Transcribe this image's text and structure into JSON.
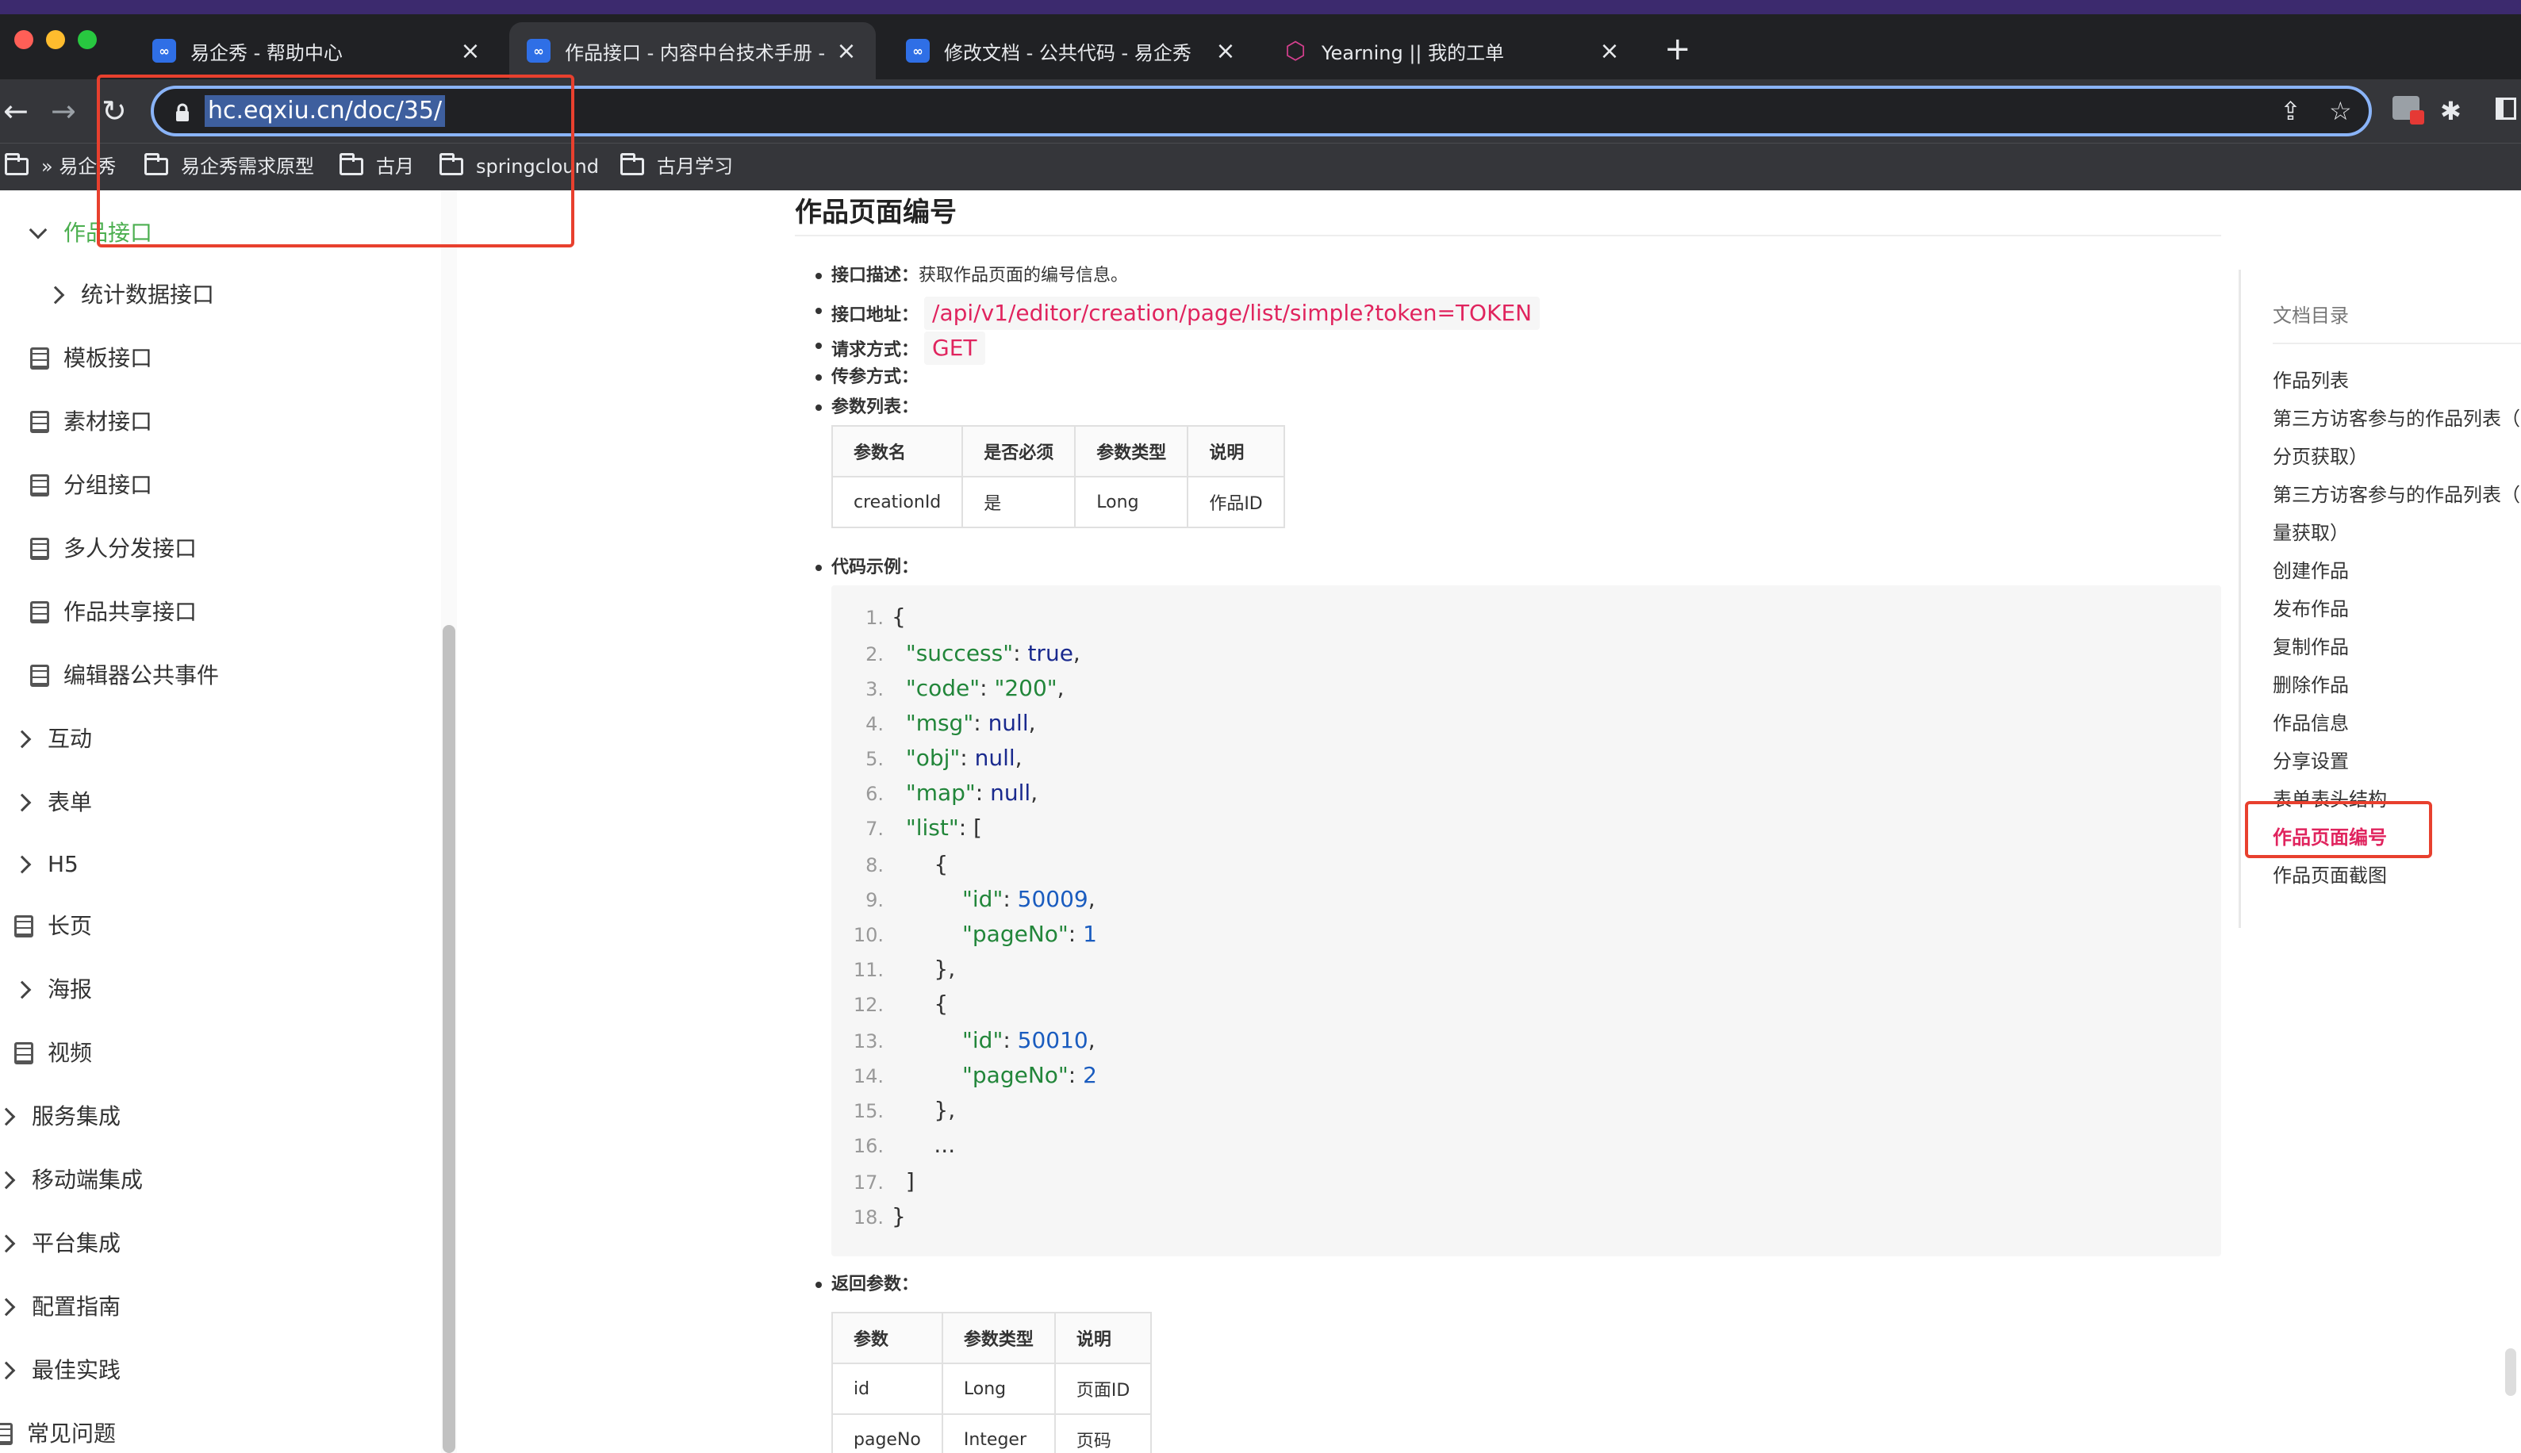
{
  "browser": {
    "tabs": [
      {
        "label": "易企秀 - 帮助中心",
        "favicon": "eqxiu-logo-icon"
      },
      {
        "label": "作品接口 - 内容中台技术手册 - 易",
        "favicon": "eqxiu-logo-icon",
        "active": true
      },
      {
        "label": "修改文档 - 公共代码 - 易企秀",
        "favicon": "eqxiu-logo-icon"
      },
      {
        "label": "Yearning || 我的工单",
        "favicon": "yearning-logo-icon"
      }
    ],
    "favicon_text": "∞",
    "close_glyph": "×",
    "newtab_glyph": "+",
    "url": "hc.eqxiu.cn/doc/35/",
    "bookmarks": [
      "» 易企秀",
      "易企秀需求原型",
      "古月",
      "springclound",
      "古月学习"
    ],
    "accent": "#8ab4f8"
  },
  "sidebar": {
    "items": [
      {
        "label": "作品接口",
        "type": "expanded",
        "active": true
      },
      {
        "label": "统计数据接口",
        "type": "collapsed"
      },
      {
        "label": "模板接口",
        "type": "doc"
      },
      {
        "label": "素材接口",
        "type": "doc"
      },
      {
        "label": "分组接口",
        "type": "doc"
      },
      {
        "label": "多人分发接口",
        "type": "doc"
      },
      {
        "label": "作品共享接口",
        "type": "doc"
      },
      {
        "label": "编辑器公共事件",
        "type": "doc"
      },
      {
        "label": "互动",
        "type": "collapsed"
      },
      {
        "label": "表单",
        "type": "collapsed"
      },
      {
        "label": "H5",
        "type": "collapsed"
      },
      {
        "label": "长页",
        "type": "doc"
      },
      {
        "label": "海报",
        "type": "collapsed"
      },
      {
        "label": "视频",
        "type": "doc"
      },
      {
        "label": "服务集成",
        "type": "collapsed"
      },
      {
        "label": "移动端集成",
        "type": "collapsed"
      },
      {
        "label": "平台集成",
        "type": "collapsed"
      },
      {
        "label": "配置指南",
        "type": "collapsed"
      },
      {
        "label": "最佳实践",
        "type": "collapsed"
      },
      {
        "label": "常见问题",
        "type": "doc"
      }
    ]
  },
  "doc": {
    "title": "作品页面编号",
    "desc_label": "接口描述：",
    "desc_value": "获取作品页面的编号信息。",
    "addr_label": "接口地址：",
    "addr_value": "/api/v1/editor/creation/page/list/simple?token=TOKEN",
    "method_label": "请求方式：",
    "method_value": "GET",
    "pass_label": "传参方式：",
    "params_label": "参数列表：",
    "params_table": {
      "headers": [
        "参数名",
        "是否必须",
        "参数类型",
        "说明"
      ],
      "rows": [
        [
          "creationId",
          "是",
          "Long",
          "作品ID"
        ]
      ]
    },
    "code_label": "代码示例：",
    "code": {
      "l1": "{",
      "k_success": "\"success\"",
      "v_success": "true",
      "k_code": "\"code\"",
      "v_code": "\"200\"",
      "k_msg": "\"msg\"",
      "v_msg": "null",
      "k_obj": "\"obj\"",
      "v_obj": "null",
      "k_map": "\"map\"",
      "v_map": "null",
      "k_list": "\"list\"",
      "v_list": "[",
      "open": "{",
      "k_id": "\"id\"",
      "v_id1": "50009",
      "v_id2": "50010",
      "k_pageNo": "\"pageNo\"",
      "v_pn1": "1",
      "v_pn2": "2",
      "close": "},",
      "ellipsis": "...",
      "close_arr": "]",
      "close_obj": "}"
    },
    "return_label": "返回参数：",
    "return_table": {
      "headers": [
        "参数",
        "参数类型",
        "说明"
      ],
      "rows": [
        [
          "id",
          "Long",
          "页面ID"
        ],
        [
          "pageNo",
          "Integer",
          "页码"
        ]
      ]
    }
  },
  "toc": {
    "title": "文档目录",
    "items": [
      "作品列表",
      "第三方访客参与的作品列表（",
      "分页获取）",
      "第三方访客参与的作品列表（",
      "量获取）",
      "创建作品",
      "发布作品",
      "复制作品",
      "删除作品",
      "作品信息",
      "分享设置",
      "表单表头结构",
      "作品页面编号",
      "作品页面截图"
    ],
    "active_index": 12,
    "active_color": "#e0245e"
  }
}
